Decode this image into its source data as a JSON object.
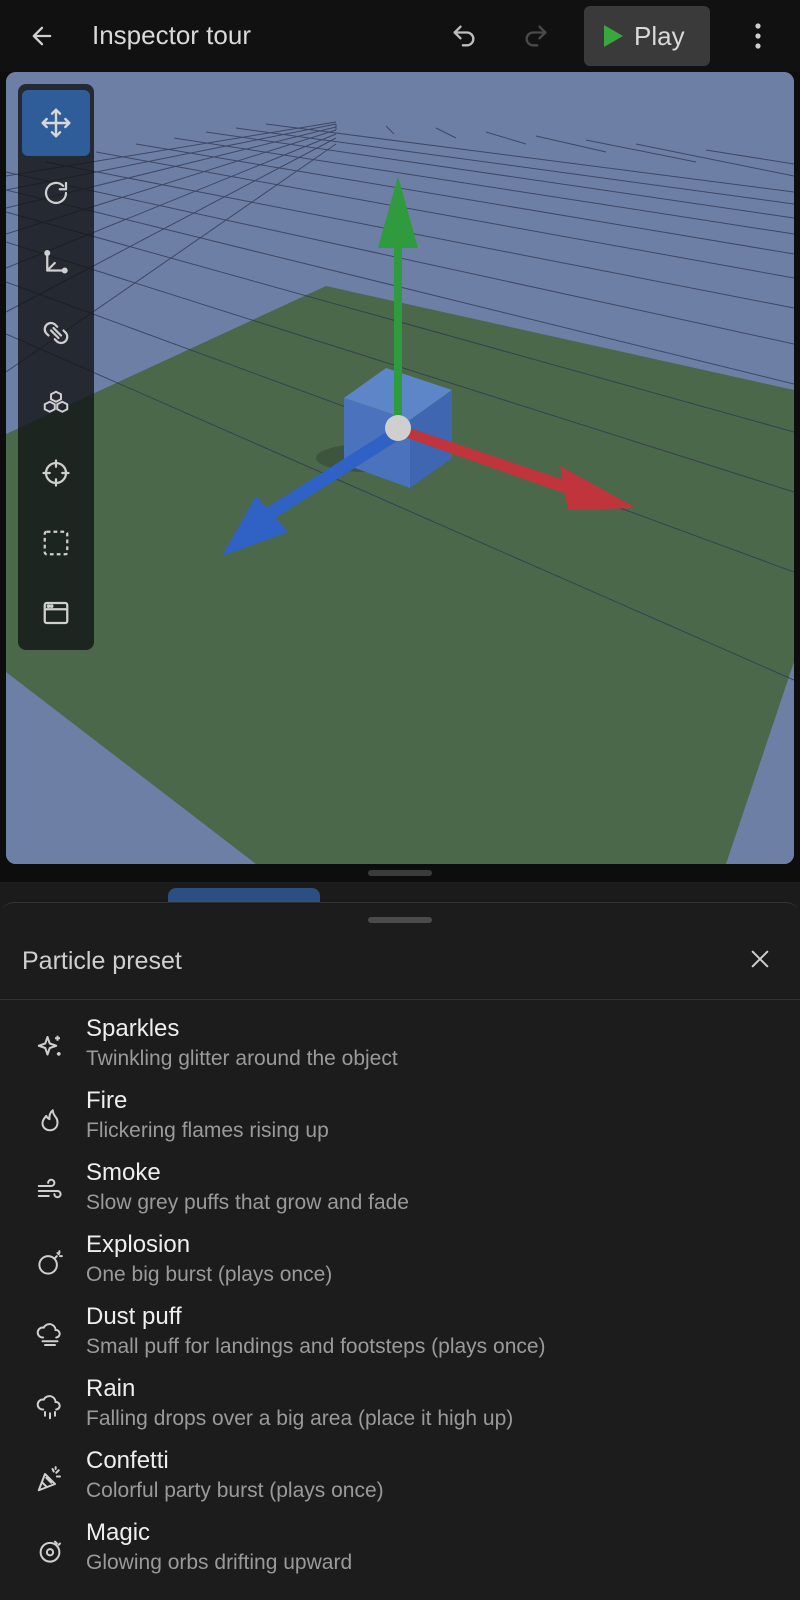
{
  "topbar": {
    "title": "Inspector tour",
    "play_label": "Play",
    "icons": [
      "arrow-left-icon",
      "undo-icon",
      "redo-icon",
      "play-triangle-icon",
      "more-vertical-icon"
    ]
  },
  "toolrail": {
    "tools": [
      {
        "name": "move-tool",
        "icon": "move-arrows-icon",
        "active": true
      },
      {
        "name": "rotate-tool",
        "icon": "rotate-icon",
        "active": false
      },
      {
        "name": "scale-tool",
        "icon": "scale-axis-icon",
        "active": false
      },
      {
        "name": "snap-tool",
        "icon": "magnet-icon",
        "active": false
      },
      {
        "name": "objects-tool",
        "icon": "cubes-icon",
        "active": false
      },
      {
        "name": "focus-tool",
        "icon": "crosshair-icon",
        "active": false
      },
      {
        "name": "select-tool",
        "icon": "dashed-square-icon",
        "active": false
      },
      {
        "name": "window-tool",
        "icon": "window-icon",
        "active": false
      }
    ]
  },
  "colors": {
    "accent": "#2f5d99",
    "axis_x": "#c0353c",
    "axis_y": "#2f9a3e",
    "axis_z": "#2f62c4",
    "sky": "#6e7fa6",
    "ground": "#4a6a4c"
  },
  "sheet": {
    "title": "Particle preset",
    "presets": [
      {
        "name": "Sparkles",
        "desc": "Twinkling glitter around the object",
        "icon": "sparkles-icon"
      },
      {
        "name": "Fire",
        "desc": "Flickering flames rising up",
        "icon": "flame-icon"
      },
      {
        "name": "Smoke",
        "desc": "Slow grey puffs that grow and fade",
        "icon": "wind-icon"
      },
      {
        "name": "Explosion",
        "desc": "One big burst (plays once)",
        "icon": "bomb-icon"
      },
      {
        "name": "Dust puff",
        "desc": "Small puff for landings and footsteps (plays once)",
        "icon": "cloud-haze-icon"
      },
      {
        "name": "Rain",
        "desc": "Falling drops over a big area (place it high up)",
        "icon": "cloud-rain-icon"
      },
      {
        "name": "Confetti",
        "desc": "Colorful party burst (plays once)",
        "icon": "party-popper-icon"
      },
      {
        "name": "Magic",
        "desc": "Glowing orbs drifting upward",
        "icon": "magic-orb-icon"
      }
    ]
  }
}
